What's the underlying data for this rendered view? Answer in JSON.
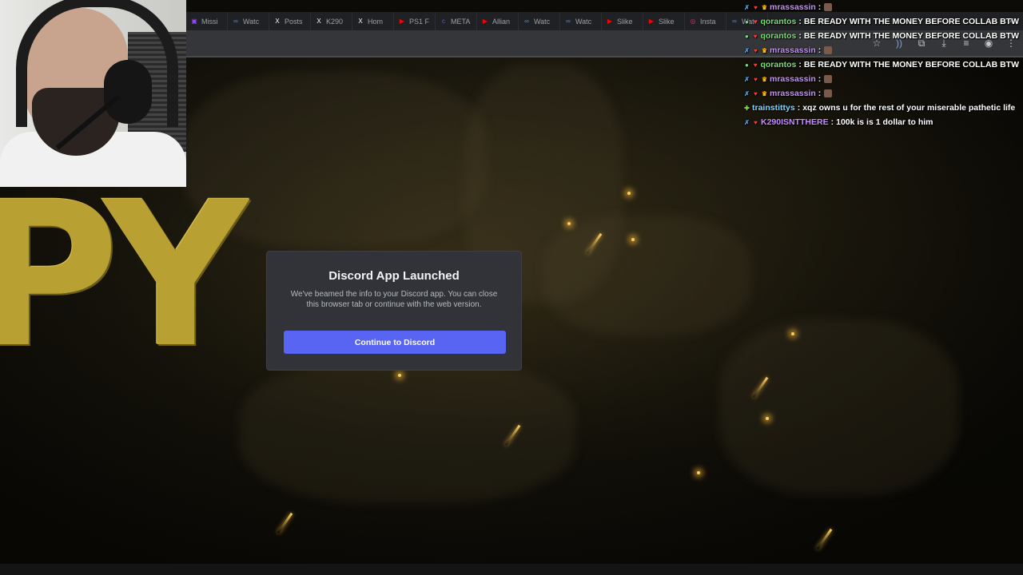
{
  "browser": {
    "tabs": [
      {
        "label": "Missi",
        "icon": "twitch-icon",
        "color": "#9146ff"
      },
      {
        "label": "Watc",
        "icon": "globe-icon",
        "color": "#4a90e2"
      },
      {
        "label": "Posts",
        "icon": "x-icon",
        "color": "#ffffff"
      },
      {
        "label": "K290",
        "icon": "x-icon",
        "color": "#ffffff"
      },
      {
        "label": "Hom",
        "icon": "x-icon",
        "color": "#ffffff"
      },
      {
        "label": "PS1 F",
        "icon": "youtube-icon",
        "color": "#ff0000"
      },
      {
        "label": "META",
        "icon": "cbm-icon",
        "color": "#7a4fd6"
      },
      {
        "label": "Allian",
        "icon": "youtube-icon",
        "color": "#ff0000"
      },
      {
        "label": "Watc",
        "icon": "globe-icon",
        "color": "#4a90e2"
      },
      {
        "label": "Watc",
        "icon": "globe-icon",
        "color": "#4a90e2"
      },
      {
        "label": "Slike",
        "icon": "youtube-icon",
        "color": "#ff0000"
      },
      {
        "label": "Slike",
        "icon": "youtube-icon",
        "color": "#ff0000"
      },
      {
        "label": "Insta",
        "icon": "instagram-icon",
        "color": "#e1306c"
      },
      {
        "label": "Watc",
        "icon": "globe-icon",
        "color": "#4a90e2"
      }
    ]
  },
  "background": {
    "big_text": "PY"
  },
  "chat": {
    "messages": [
      {
        "user": "mrassassin",
        "text": "",
        "emote": true,
        "cls": "u-mr",
        "badges": [
          "sword",
          "heart",
          "crown"
        ]
      },
      {
        "user": "qorantos",
        "text": "BE READY WITH THE MONEY BEFORE COLLAB BTW",
        "emote": false,
        "cls": "u-q",
        "badges": [
          "gem",
          "heart"
        ]
      },
      {
        "user": "qorantos",
        "text": "BE READY WITH THE MONEY BEFORE COLLAB BTW",
        "emote": false,
        "cls": "u-q",
        "badges": [
          "gem",
          "heart"
        ]
      },
      {
        "user": "mrassassin",
        "text": "",
        "emote": true,
        "cls": "u-mr",
        "badges": [
          "sword",
          "heart",
          "crown"
        ]
      },
      {
        "user": "qorantos",
        "text": "BE READY WITH THE MONEY BEFORE COLLAB BTW",
        "emote": false,
        "cls": "u-q",
        "badges": [
          "gem",
          "heart"
        ]
      },
      {
        "user": "mrassassin",
        "text": "",
        "emote": true,
        "cls": "u-mr",
        "badges": [
          "sword",
          "heart",
          "crown"
        ]
      },
      {
        "user": "mrassassin",
        "text": "",
        "emote": true,
        "cls": "u-mr",
        "badges": [
          "sword",
          "heart",
          "crown"
        ]
      },
      {
        "user": "trainstittys",
        "text": "xqz owns u for the rest of your miserable pathetic life",
        "emote": false,
        "cls": "u-t",
        "badges": [
          "plus"
        ]
      },
      {
        "user": "K290ISNTTHERE",
        "text": "100k is is 1 dollar to him",
        "emote": false,
        "cls": "u-k",
        "badges": [
          "sword",
          "heart"
        ]
      }
    ]
  },
  "dialog": {
    "title": "Discord App Launched",
    "body": "We've beamed the info to your Discord app. You can close this browser tab or continue with the web version.",
    "button_label": "Continue to Discord",
    "button_color": "#5865f2"
  }
}
